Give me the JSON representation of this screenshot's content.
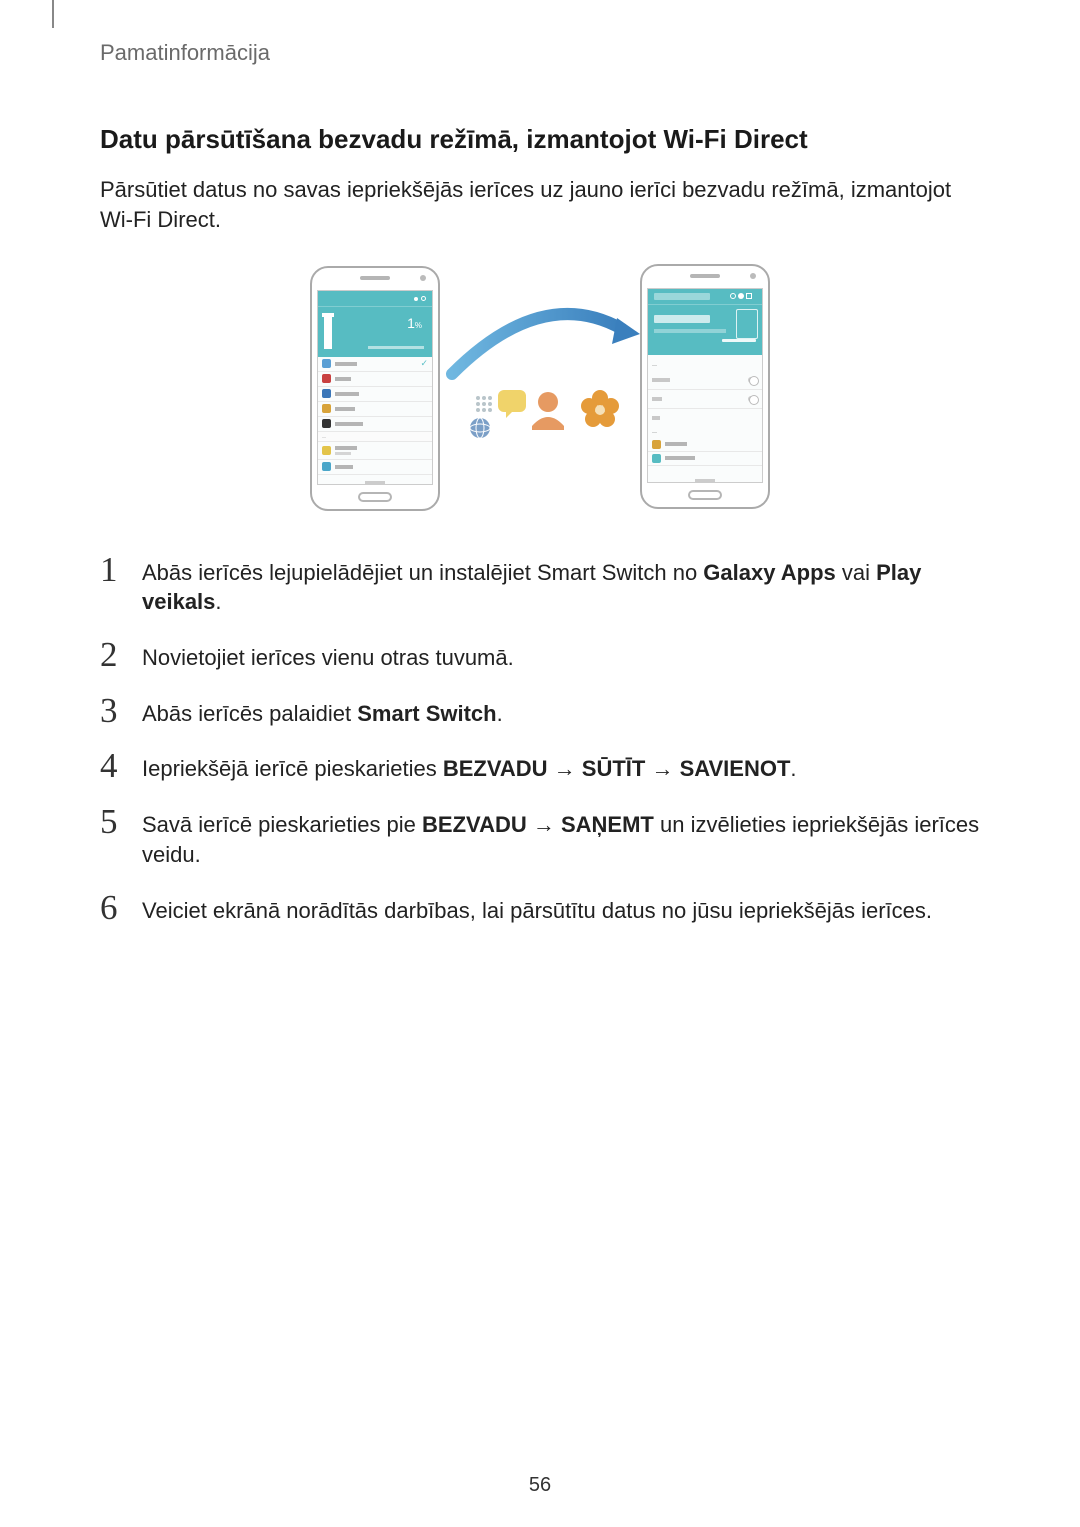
{
  "header": {
    "breadcrumb": "Pamatinformācija"
  },
  "section": {
    "title": "Datu pārsūtīšana bezvadu režīmā, izmantojot Wi-Fi Direct",
    "intro": "Pārsūtiet datus no savas iepriekšējās ierīces uz jauno ierīci bezvadu režīmā, izmantojot Wi-Fi Direct."
  },
  "figure": {
    "left_phone_percent": "1",
    "left_phone_subscript": "%"
  },
  "steps": [
    {
      "num": "1",
      "parts": [
        {
          "t": "Abās ierīcēs lejupielādējiet un instalējiet Smart Switch no "
        },
        {
          "t": "Galaxy Apps",
          "b": true
        },
        {
          "t": " vai "
        },
        {
          "t": "Play veikals",
          "b": true
        },
        {
          "t": "."
        }
      ]
    },
    {
      "num": "2",
      "parts": [
        {
          "t": "Novietojiet ierīces vienu otras tuvumā."
        }
      ]
    },
    {
      "num": "3",
      "parts": [
        {
          "t": "Abās ierīcēs palaidiet "
        },
        {
          "t": "Smart Switch",
          "b": true
        },
        {
          "t": "."
        }
      ]
    },
    {
      "num": "4",
      "parts": [
        {
          "t": "Iepriekšējā ierīcē pieskarieties "
        },
        {
          "t": "BEZVADU",
          "b": true
        },
        {
          "t": " → "
        },
        {
          "t": "SŪTĪT",
          "b": true
        },
        {
          "t": " → "
        },
        {
          "t": "SAVIENOT",
          "b": true
        },
        {
          "t": "."
        }
      ]
    },
    {
      "num": "5",
      "parts": [
        {
          "t": "Savā ierīcē pieskarieties pie "
        },
        {
          "t": "BEZVADU",
          "b": true
        },
        {
          "t": " → "
        },
        {
          "t": "SAŅEMT",
          "b": true
        },
        {
          "t": " un izvēlieties iepriekšējās ierīces veidu."
        }
      ]
    },
    {
      "num": "6",
      "parts": [
        {
          "t": "Veiciet ekrānā norādītās darbības, lai pārsūtītu datus no jūsu iepriekšējās ierīces."
        }
      ]
    }
  ],
  "page_number": "56"
}
